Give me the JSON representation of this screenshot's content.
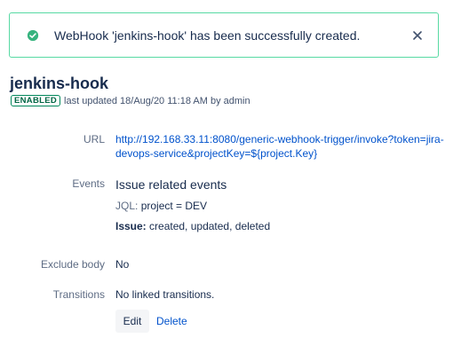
{
  "flag": {
    "message": "WebHook 'jenkins-hook' has been successfully created.",
    "icon": "success-check-icon",
    "close_icon": "close-icon"
  },
  "webhook": {
    "name": "jenkins-hook",
    "status": "ENABLED",
    "last_updated": "last updated 18/Aug/20 11:18 AM by admin"
  },
  "details": {
    "url_label": "URL",
    "url_value": "http://192.168.33.11:8080/generic-webhook-trigger/invoke?token=jira-devops-service&projectKey=${project.Key}",
    "events_label": "Events",
    "events_title": "Issue related events",
    "jql_key": "JQL:",
    "jql_value": "project = DEV",
    "issue_key": "Issue:",
    "issue_value": "created, updated, deleted",
    "exclude_label": "Exclude body",
    "exclude_value": "No",
    "transitions_label": "Transitions",
    "transitions_value": "No linked transitions."
  },
  "actions": {
    "edit": "Edit",
    "delete": "Delete"
  },
  "colors": {
    "success": "#36b37e",
    "link": "#0052cc",
    "text": "#172b4d",
    "muted": "#5e6c84"
  }
}
